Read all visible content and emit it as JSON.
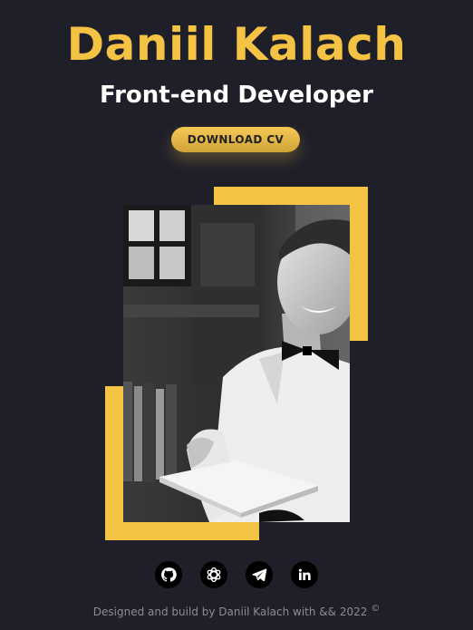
{
  "hero": {
    "name": "Daniil Kalach",
    "role": "Front-end Developer",
    "cv_button": "DOWNLOAD CV"
  },
  "colors": {
    "background": "#1f1f29",
    "accent": "#f5c344",
    "footer_text": "#8c8c95"
  },
  "socials": [
    {
      "icon": "github-icon"
    },
    {
      "icon": "openai-icon"
    },
    {
      "icon": "telegram-icon"
    },
    {
      "icon": "linkedin-icon"
    }
  ],
  "footer": {
    "text": "Designed and build by Daniil Kalach with  &&  2022",
    "copyright_symbol": "©"
  }
}
